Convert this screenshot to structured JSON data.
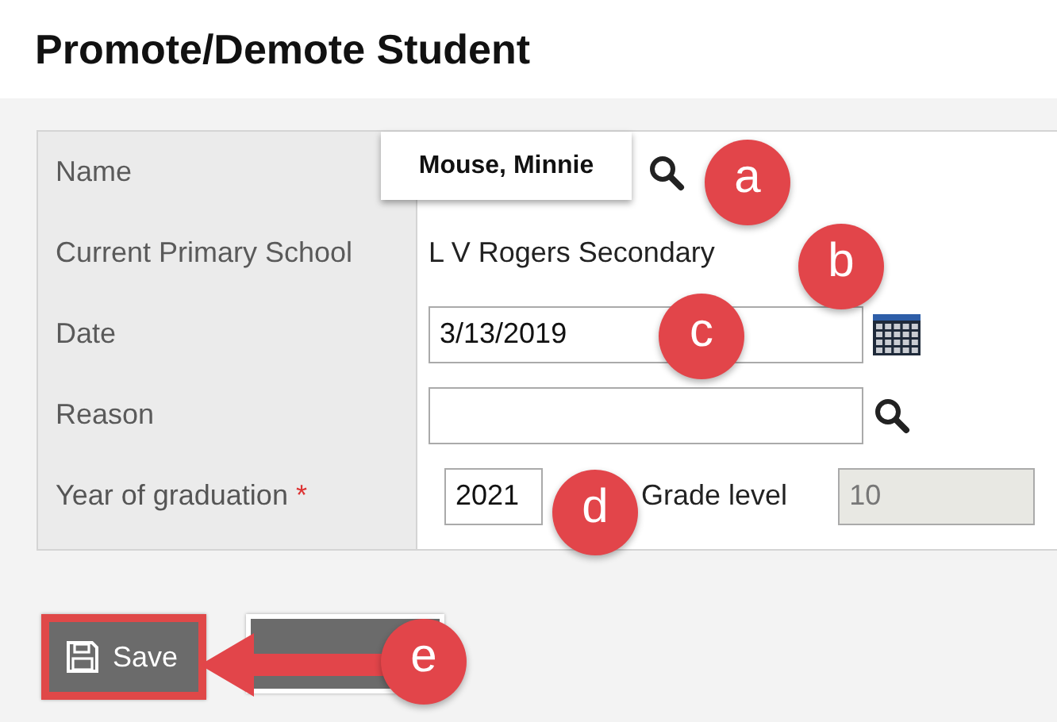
{
  "title": "Promote/Demote Student",
  "fields": [
    {
      "kind": "lookup",
      "label": "Name",
      "value": "Mouse, Minnie",
      "required": false
    },
    {
      "kind": "text",
      "label": "Current Primary School",
      "value": "L V Rogers Secondary",
      "required": false
    },
    {
      "kind": "date",
      "label": "Date",
      "value": "3/13/2019",
      "required": false
    },
    {
      "kind": "picker",
      "label": "Reason",
      "required": false
    },
    {
      "kind": "year",
      "label": "Year of graduation",
      "value": "2021",
      "required": true,
      "required_mark": "*",
      "extra_label": "Grade level",
      "extra_value": "10",
      "extra_disabled": true
    }
  ],
  "buttons": [
    {
      "label": "Save",
      "highlighted": true
    }
  ],
  "callouts": [
    "a",
    "b",
    "c",
    "d",
    "e"
  ]
}
